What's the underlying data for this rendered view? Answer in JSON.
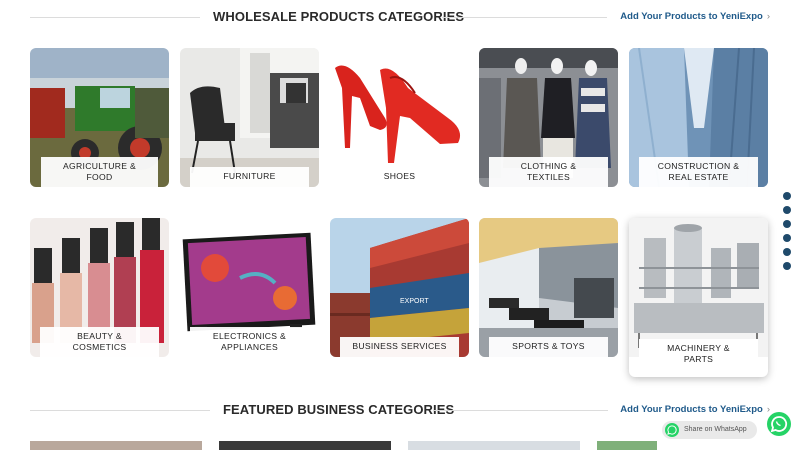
{
  "wholesale": {
    "title": "WHOLESALE PRODUCTS CATEGORIES",
    "link": "Add Your Products to YeniExpo",
    "categories": [
      {
        "label": "AGRICULTURE & FOOD"
      },
      {
        "label": "FURNITURE"
      },
      {
        "label": "SHOES"
      },
      {
        "label": "CLOTHING & TEXTILES"
      },
      {
        "label": "CONSTRUCTION & REAL ESTATE"
      },
      {
        "label": "BEAUTY & COSMETICS"
      },
      {
        "label": "ELECTRONICS & APPLIANCES"
      },
      {
        "label": "BUSINESS SERVICES"
      },
      {
        "label": "SPORTS & TOYS"
      },
      {
        "label": "MACHINERY & PARTS"
      }
    ]
  },
  "featured": {
    "title": "FEATURED BUSINESS CATEGORIES",
    "link": "Add Your Products to YeniExpo"
  },
  "whatsapp": {
    "bubble": "Share on WhatsApp",
    "color": "#25d366"
  },
  "icons": {
    "chevron": "chevron-right-icon",
    "whatsapp": "whatsapp-icon"
  },
  "accent": "#1f5a8a"
}
